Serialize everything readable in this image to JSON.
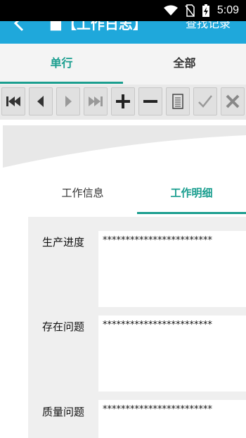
{
  "status_bar": {
    "time": "5:09",
    "icons": [
      "wifi-icon",
      "sim-off-icon",
      "battery-charging-icon"
    ]
  },
  "app_bar": {
    "title": "■【工作日志】",
    "action": "查找记录",
    "back_icon": "back-arrow-icon",
    "color": "#1fa8db"
  },
  "top_tabs": [
    {
      "label": "单行"
    },
    {
      "label": "全部"
    }
  ],
  "toolbar": {
    "buttons": [
      "first-record-icon",
      "previous-record-icon",
      "next-record-icon",
      "last-record-icon",
      "add-icon",
      "delete-icon",
      "document-icon",
      "confirm-icon",
      "cancel-icon"
    ]
  },
  "detail_tabs": [
    {
      "label": "工作信息"
    },
    {
      "label": "工作明细"
    }
  ],
  "fields": [
    {
      "label": "生产进度",
      "value": "************************"
    },
    {
      "label": "存在问题",
      "value": "************************"
    },
    {
      "label": "质量问题",
      "value": "************************"
    }
  ],
  "accent_color": "#1a9e8f"
}
